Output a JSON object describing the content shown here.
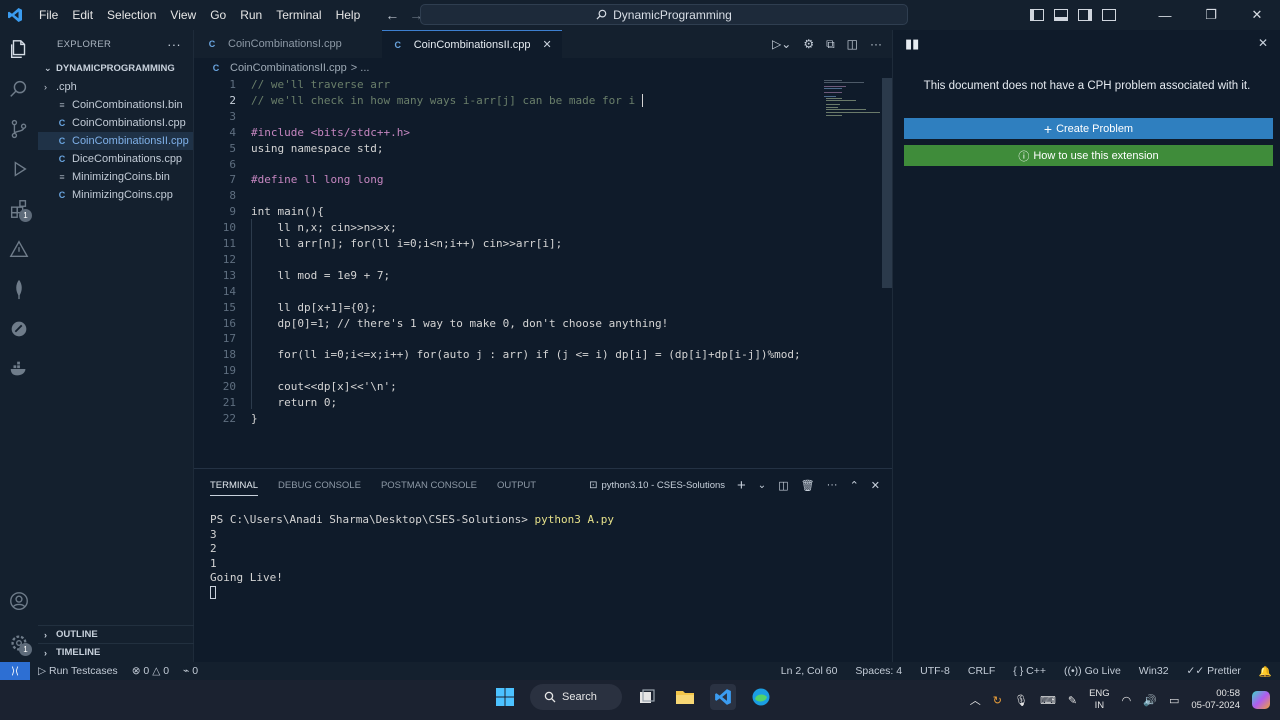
{
  "menu": [
    "File",
    "Edit",
    "Selection",
    "View",
    "Go",
    "Run",
    "Terminal",
    "Help"
  ],
  "command_center": "DynamicProgramming",
  "explorer": {
    "title": "EXPLORER",
    "folder": "DYNAMICPROGRAMMING",
    "items": [
      {
        "name": ".cph",
        "type": "folder"
      },
      {
        "name": "CoinCombinationsI.bin",
        "type": "bin"
      },
      {
        "name": "CoinCombinationsI.cpp",
        "type": "cpp"
      },
      {
        "name": "CoinCombinationsII.cpp",
        "type": "cpp"
      },
      {
        "name": "DiceCombinations.cpp",
        "type": "cpp"
      },
      {
        "name": "MinimizingCoins.bin",
        "type": "bin"
      },
      {
        "name": "MinimizingCoins.cpp",
        "type": "cpp"
      }
    ],
    "outline": "OUTLINE",
    "timeline": "TIMELINE"
  },
  "activity_badges": {
    "extensions": "1",
    "accounts": "1"
  },
  "tabs": [
    {
      "label": "CoinCombinationsI.cpp"
    },
    {
      "label": "CoinCombinationsII.cpp"
    }
  ],
  "breadcrumb": {
    "file": "CoinCombinationsII.cpp",
    "rest": "> ..."
  },
  "code": [
    "// we'll traverse arr",
    "// we'll check in how many ways i-arr[j] can be made for i ",
    "",
    "#include <bits/stdc++.h>",
    "using namespace std;",
    "",
    "#define ll long long",
    "",
    "int main(){",
    "    ll n,x; cin>>n>>x;",
    "    ll arr[n]; for(ll i=0;i<n;i++) cin>>arr[i];",
    "",
    "    ll mod = 1e9 + 7;",
    "",
    "    ll dp[x+1]={0};",
    "    dp[0]=1; // there's 1 way to make 0, don't choose anything!",
    "",
    "    for(ll i=0;i<=x;i++) for(auto j : arr) if (j <= i) dp[i] = (dp[i]+dp[i-j])%mod;",
    "",
    "    cout<<dp[x]<<'\\n';",
    "    return 0;",
    "}"
  ],
  "panel": {
    "tabs": [
      "TERMINAL",
      "DEBUG CONSOLE",
      "POSTMAN CONSOLE",
      "OUTPUT"
    ],
    "terminal_name": "python3.10 - CSES-Solutions",
    "prompt": "PS C:\\Users\\Anadi Sharma\\Desktop\\CSES-Solutions>",
    "command": "python3 A.py",
    "output": [
      "3",
      "2",
      "1",
      "Going Live!"
    ]
  },
  "cph": {
    "message": "This document does not have a CPH problem associated with it.",
    "create_label": "Create Problem",
    "help_label": "How to use this extension"
  },
  "status": {
    "run_testcases": "Run Testcases",
    "errors": "0",
    "warnings": "0",
    "ports": "0",
    "position": "Ln 2, Col 60",
    "spaces": "Spaces: 4",
    "encoding": "UTF-8",
    "eol": "CRLF",
    "language": "C++",
    "golive": "Go Live",
    "platform": "Win32",
    "prettier": "Prettier"
  },
  "taskbar": {
    "search": "Search",
    "lang_top": "ENG",
    "lang_bottom": "IN",
    "time": "00:58",
    "date": "05-07-2024"
  },
  "colors": {
    "accent": "#2d6fd3",
    "create_button": "#2f7fbf",
    "help_button": "#3f8c3a",
    "background": "#0f1b2a"
  }
}
